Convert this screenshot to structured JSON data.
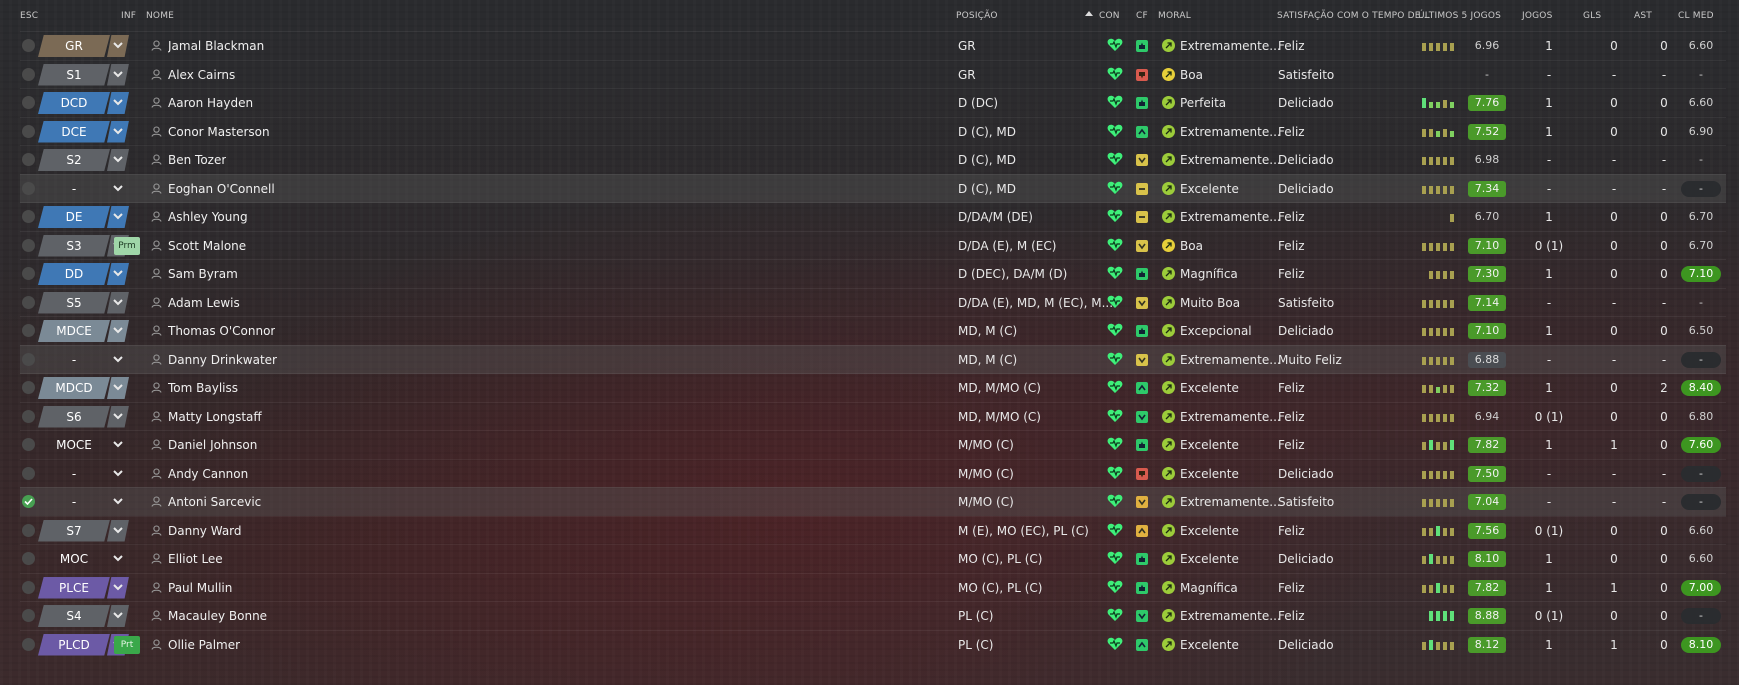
{
  "columns": {
    "esc": "ESC",
    "inf": "INF",
    "name": "NOME",
    "posicao": "POSIÇÃO",
    "con": "CON",
    "cf": "CF",
    "moral": "MORAL",
    "satis": "SATISFAÇÃO COM O TEMPO DE...",
    "form": "ÚLTIMOS 5 JOGOS",
    "jogos": "JOGOS",
    "gls": "GLS",
    "ast": "AST",
    "avg": "CL MED"
  },
  "colors": {
    "gk": "#7b6a55",
    "def": "#3f78b5",
    "sub": "#5f6267",
    "mid": "#7b8a96",
    "plce": "#6c5aa6",
    "con_heart": "#3ef07a",
    "cf_green": "#2ec96a",
    "cf_red": "#d85a4e",
    "cf_yellow": "#d8c24a",
    "cf_orange": "#e0b040",
    "morale_green": "#9ccc3a",
    "morale_yellow": "#e6cf3a"
  },
  "rows": [
    {
      "sel": "GR",
      "pos_type": "gk",
      "inf": "",
      "name": "Jamal Blackman",
      "posicao": "GR",
      "cf": "up_green",
      "moral": "green",
      "morale": "Extremamente...",
      "satis": "Feliz",
      "form": [
        4,
        4,
        4,
        4,
        4
      ],
      "rating": "6.96",
      "rating_type": "plain",
      "jogos": "1",
      "gls": "0",
      "ast": "0",
      "avg": "6.60",
      "avg_type": "plain",
      "hl": false,
      "checked": false
    },
    {
      "sel": "S1",
      "pos_type": "sub",
      "inf": "",
      "name": "Alex Cairns",
      "posicao": "GR",
      "cf": "down_red",
      "moral": "yellow",
      "morale": "Boa",
      "satis": "Satisfeito",
      "form": [],
      "rating": "-",
      "rating_type": "plain",
      "jogos": "-",
      "gls": "-",
      "ast": "-",
      "avg": "-",
      "avg_type": "plain",
      "hl": false,
      "checked": false
    },
    {
      "sel": "DCD",
      "pos_type": "def",
      "inf": "",
      "name": "Aaron Hayden",
      "posicao": "D (DC)",
      "cf": "up_green",
      "moral": "green",
      "morale": "Perfeita",
      "satis": "Deliciado",
      "form": [
        5,
        3,
        3,
        4,
        3
      ],
      "rating": "7.76",
      "rating_type": "good",
      "jogos": "1",
      "gls": "0",
      "ast": "0",
      "avg": "6.60",
      "avg_type": "plain",
      "hl": false,
      "checked": false
    },
    {
      "sel": "DCE",
      "pos_type": "def",
      "inf": "",
      "name": "Conor Masterson",
      "posicao": "D (C), MD",
      "cf": "chev_green",
      "moral": "green",
      "morale": "Extremamente...",
      "satis": "Feliz",
      "form": [
        4,
        4,
        3,
        4,
        3
      ],
      "rating": "7.52",
      "rating_type": "good",
      "jogos": "1",
      "gls": "0",
      "ast": "0",
      "avg": "6.90",
      "avg_type": "plain",
      "hl": false,
      "checked": false
    },
    {
      "sel": "S2",
      "pos_type": "sub",
      "inf": "",
      "name": "Ben Tozer",
      "posicao": "D (C), MD",
      "cf": "chevd_yellow",
      "moral": "green",
      "morale": "Extremamente...",
      "satis": "Deliciado",
      "form": [
        4,
        4,
        4,
        4,
        4
      ],
      "rating": "6.98",
      "rating_type": "plain",
      "jogos": "-",
      "gls": "-",
      "ast": "-",
      "avg": "-",
      "avg_type": "plain",
      "hl": false,
      "checked": false
    },
    {
      "sel": "-",
      "pos_type": "none",
      "inf": "",
      "name": "Eoghan O'Connell",
      "posicao": "D (C), MD",
      "cf": "eq_yellow",
      "moral": "green",
      "morale": "Excelente",
      "satis": "Deliciado",
      "form": [
        4,
        4,
        4,
        4,
        4
      ],
      "rating": "7.34",
      "rating_type": "good",
      "jogos": "-",
      "gls": "-",
      "ast": "-",
      "avg": "-",
      "avg_type": "dark",
      "hl": true,
      "checked": false
    },
    {
      "sel": "DE",
      "pos_type": "def",
      "inf": "",
      "name": "Ashley Young",
      "posicao": "D/DA/M (DE)",
      "cf": "eq_yellow",
      "moral": "green",
      "morale": "Extremamente...",
      "satis": "Feliz",
      "form": [
        0,
        0,
        0,
        0,
        4
      ],
      "rating": "6.70",
      "rating_type": "plain",
      "jogos": "1",
      "gls": "0",
      "ast": "0",
      "avg": "6.70",
      "avg_type": "plain",
      "hl": false,
      "checked": false
    },
    {
      "sel": "S3",
      "pos_type": "sub",
      "inf": "Prm",
      "name": "Scott Malone",
      "posicao": "D/DA (E), M (EC)",
      "cf": "chevd_yellow",
      "moral": "yellow",
      "morale": "Boa",
      "satis": "Feliz",
      "form": [
        4,
        4,
        4,
        4,
        4
      ],
      "rating": "7.10",
      "rating_type": "good",
      "jogos": "0 (1)",
      "gls": "0",
      "ast": "0",
      "avg": "6.70",
      "avg_type": "plain",
      "hl": false,
      "checked": false
    },
    {
      "sel": "DD",
      "pos_type": "def",
      "inf": "",
      "name": "Sam Byram",
      "posicao": "D (DEC), DA/M (D)",
      "cf": "up_green",
      "moral": "green",
      "morale": "Magnífica",
      "satis": "Feliz",
      "form": [
        0,
        4,
        4,
        4,
        4
      ],
      "rating": "7.30",
      "rating_type": "good",
      "jogos": "1",
      "gls": "0",
      "ast": "0",
      "avg": "7.10",
      "avg_type": "good",
      "hl": false,
      "checked": false
    },
    {
      "sel": "S5",
      "pos_type": "sub",
      "inf": "",
      "name": "Adam Lewis",
      "posicao": "D/DA (E), MD, M (EC), M...",
      "cf": "chevd_yellow",
      "moral": "green",
      "morale": "Muito Boa",
      "satis": "Satisfeito",
      "form": [
        4,
        4,
        4,
        4,
        4
      ],
      "rating": "7.14",
      "rating_type": "good",
      "jogos": "-",
      "gls": "-",
      "ast": "-",
      "avg": "-",
      "avg_type": "plain",
      "hl": false,
      "checked": false
    },
    {
      "sel": "MDCE",
      "pos_type": "mid",
      "inf": "",
      "name": "Thomas O'Connor",
      "posicao": "MD, M (C)",
      "cf": "up_green",
      "moral": "green",
      "morale": "Excepcional",
      "satis": "Deliciado",
      "form": [
        4,
        4,
        4,
        4,
        4
      ],
      "rating": "7.10",
      "rating_type": "good",
      "jogos": "1",
      "gls": "0",
      "ast": "0",
      "avg": "6.50",
      "avg_type": "plain",
      "hl": false,
      "checked": false
    },
    {
      "sel": "-",
      "pos_type": "none",
      "inf": "",
      "name": "Danny Drinkwater",
      "posicao": "MD, M (C)",
      "cf": "chevd_yellow",
      "moral": "green",
      "morale": "Extremamente...",
      "satis": "Muito Feliz",
      "form": [
        4,
        4,
        4,
        4,
        4
      ],
      "rating": "6.88",
      "rating_type": "mid",
      "jogos": "-",
      "gls": "-",
      "ast": "-",
      "avg": "-",
      "avg_type": "dark",
      "hl": true,
      "checked": false
    },
    {
      "sel": "MDCD",
      "pos_type": "mid",
      "inf": "",
      "name": "Tom Bayliss",
      "posicao": "MD, M/MO (C)",
      "cf": "chev_green",
      "moral": "green",
      "morale": "Excelente",
      "satis": "Feliz",
      "form": [
        4,
        4,
        3,
        4,
        4
      ],
      "rating": "7.32",
      "rating_type": "good",
      "jogos": "1",
      "gls": "0",
      "ast": "2",
      "avg": "8.40",
      "avg_type": "good",
      "hl": false,
      "checked": false
    },
    {
      "sel": "S6",
      "pos_type": "sub",
      "inf": "",
      "name": "Matty Longstaff",
      "posicao": "MD, M/MO (C)",
      "cf": "chevd_green",
      "moral": "green",
      "morale": "Extremamente...",
      "satis": "Feliz",
      "form": [
        4,
        4,
        4,
        4,
        4
      ],
      "rating": "6.94",
      "rating_type": "plain",
      "jogos": "0 (1)",
      "gls": "0",
      "ast": "0",
      "avg": "6.80",
      "avg_type": "plain",
      "hl": false,
      "checked": false
    },
    {
      "sel": "MOCE",
      "pos_type": "none",
      "inf": "",
      "name": "Daniel Johnson",
      "posicao": "M/MO (C)",
      "cf": "up_green",
      "moral": "green",
      "morale": "Excelente",
      "satis": "Feliz",
      "form": [
        4,
        5,
        4,
        4,
        5
      ],
      "rating": "7.82",
      "rating_type": "good",
      "jogos": "1",
      "gls": "1",
      "ast": "0",
      "avg": "7.60",
      "avg_type": "good",
      "hl": false,
      "checked": false
    },
    {
      "sel": "-",
      "pos_type": "none",
      "inf": "",
      "name": "Andy Cannon",
      "posicao": "M/MO (C)",
      "cf": "down_red",
      "moral": "green",
      "morale": "Excelente",
      "satis": "Deliciado",
      "form": [
        4,
        4,
        4,
        4,
        4
      ],
      "rating": "7.50",
      "rating_type": "good",
      "jogos": "-",
      "gls": "-",
      "ast": "-",
      "avg": "-",
      "avg_type": "dark",
      "hl": false,
      "checked": false
    },
    {
      "sel": "-",
      "pos_type": "none",
      "inf": "",
      "name": "Antoni Sarcevic",
      "posicao": "M/MO (C)",
      "cf": "chevd_orange",
      "moral": "green",
      "morale": "Extremamente...",
      "satis": "Satisfeito",
      "form": [
        4,
        4,
        4,
        4,
        4
      ],
      "rating": "7.04",
      "rating_type": "good",
      "jogos": "-",
      "gls": "-",
      "ast": "-",
      "avg": "-",
      "avg_type": "dark",
      "hl": true,
      "checked": true
    },
    {
      "sel": "S7",
      "pos_type": "sub",
      "inf": "",
      "name": "Danny Ward",
      "posicao": "M (E), MO (EC), PL (C)",
      "cf": "chev_orange",
      "moral": "green",
      "morale": "Excelente",
      "satis": "Feliz",
      "form": [
        4,
        4,
        5,
        4,
        4
      ],
      "rating": "7.56",
      "rating_type": "good",
      "jogos": "0 (1)",
      "gls": "0",
      "ast": "0",
      "avg": "6.60",
      "avg_type": "plain",
      "hl": false,
      "checked": false
    },
    {
      "sel": "MOC",
      "pos_type": "none",
      "inf": "",
      "name": "Elliot Lee",
      "posicao": "MO (C), PL (C)",
      "cf": "up_green",
      "moral": "green",
      "morale": "Excelente",
      "satis": "Deliciado",
      "form": [
        4,
        5,
        4,
        4,
        4
      ],
      "rating": "8.10",
      "rating_type": "good",
      "jogos": "1",
      "gls": "0",
      "ast": "0",
      "avg": "6.60",
      "avg_type": "plain",
      "hl": false,
      "checked": false
    },
    {
      "sel": "PLCE",
      "pos_type": "plce",
      "inf": "",
      "name": "Paul Mullin",
      "posicao": "MO (C), PL (C)",
      "cf": "up_green",
      "moral": "green",
      "morale": "Magnífica",
      "satis": "Feliz",
      "form": [
        4,
        4,
        5,
        4,
        4
      ],
      "rating": "7.82",
      "rating_type": "good",
      "jogos": "1",
      "gls": "1",
      "ast": "0",
      "avg": "7.00",
      "avg_type": "good",
      "hl": false,
      "checked": false
    },
    {
      "sel": "S4",
      "pos_type": "sub",
      "inf": "",
      "name": "Macauley Bonne",
      "posicao": "PL (C)",
      "cf": "chevd_green",
      "moral": "green",
      "morale": "Extremamente...",
      "satis": "Feliz",
      "form": [
        0,
        5,
        5,
        5,
        5
      ],
      "rating": "8.88",
      "rating_type": "good",
      "jogos": "0 (1)",
      "gls": "0",
      "ast": "0",
      "avg": "-",
      "avg_type": "dark",
      "hl": false,
      "checked": false
    },
    {
      "sel": "PLCD",
      "pos_type": "plce",
      "inf": "Prt",
      "name": "Ollie Palmer",
      "posicao": "PL (C)",
      "cf": "chev_green",
      "moral": "green",
      "morale": "Excelente",
      "satis": "Deliciado",
      "form": [
        4,
        5,
        4,
        4,
        4
      ],
      "rating": "8.12",
      "rating_type": "good",
      "jogos": "1",
      "gls": "1",
      "ast": "0",
      "avg": "8.10",
      "avg_type": "good",
      "hl": false,
      "checked": false
    }
  ]
}
